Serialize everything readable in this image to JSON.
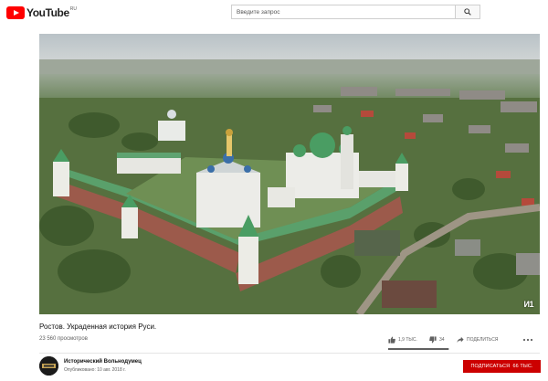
{
  "masthead": {
    "logo_text": "YouTube",
    "logo_region": "RU",
    "search_placeholder": "Введите запрос"
  },
  "video": {
    "title": "Ростов. Украденная история Руси.",
    "views": "23 560 просмотров",
    "watermark": "И1"
  },
  "actions": {
    "likes": "1,9 ТЫС.",
    "dislikes": "34",
    "share_label": "ПОДЕЛИТЬСЯ",
    "like_ratio": 0.98
  },
  "channel": {
    "name": "Исторический Вольнодумец",
    "published": "Опубликовано: 10 авг. 2018 г.",
    "subscribe_label": "ПОДПИСАТЬСЯ",
    "subscriber_count": "66 ТЫС."
  },
  "icons": {
    "search": "search-icon",
    "like": "thumbs-up-icon",
    "dislike": "thumbs-down-icon",
    "share": "share-arrow-icon",
    "more": "more-dots-icon"
  },
  "colors": {
    "brand_red": "#ff0000",
    "subscribe_red": "#cc0000",
    "text_primary": "#111111",
    "text_secondary": "#606060"
  }
}
